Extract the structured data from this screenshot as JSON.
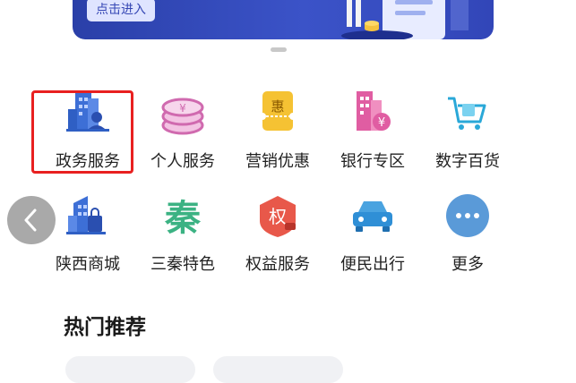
{
  "banner": {
    "button_label": "点击进入"
  },
  "services_row1": [
    {
      "label": "政务服务",
      "icon": "government-building-icon"
    },
    {
      "label": "个人服务",
      "icon": "coin-stack-icon"
    },
    {
      "label": "营销优惠",
      "icon": "coupon-ticket-icon"
    },
    {
      "label": "银行专区",
      "icon": "bank-building-icon"
    },
    {
      "label": "数字百货",
      "icon": "shopping-cart-icon"
    }
  ],
  "services_row2": [
    {
      "label": "陕西商城",
      "icon": "mall-building-icon"
    },
    {
      "label": "三秦特色",
      "icon": "qin-character-icon"
    },
    {
      "label": "权益服务",
      "icon": "rights-badge-icon"
    },
    {
      "label": "便民出行",
      "icon": "car-icon"
    },
    {
      "label": "更多",
      "icon": "more-dots-icon"
    }
  ],
  "section": {
    "title": "热门推荐"
  },
  "colors": {
    "accent_blue": "#3b53c8",
    "highlight_red": "#e82020"
  }
}
